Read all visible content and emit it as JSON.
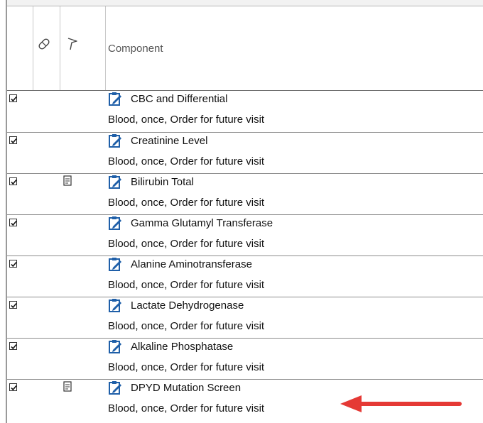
{
  "header": {
    "component_label": "Component",
    "icons": [
      "pill-icon",
      "flag-icon"
    ]
  },
  "rows": [
    {
      "name": "CBC and Differential",
      "detail": "Blood, once, Order for future visit",
      "checked": true,
      "has_note": false
    },
    {
      "name": "Creatinine Level",
      "detail": "Blood, once, Order for future visit",
      "checked": true,
      "has_note": false
    },
    {
      "name": "Bilirubin Total",
      "detail": "Blood, once, Order for future visit",
      "checked": true,
      "has_note": true
    },
    {
      "name": "Gamma Glutamyl Transferase",
      "detail": "Blood, once, Order for future visit",
      "checked": true,
      "has_note": false
    },
    {
      "name": "Alanine Aminotransferase",
      "detail": "Blood, once, Order for future visit",
      "checked": true,
      "has_note": false
    },
    {
      "name": "Lactate Dehydrogenase",
      "detail": "Blood, once, Order for future visit",
      "checked": true,
      "has_note": false
    },
    {
      "name": "Alkaline Phosphatase",
      "detail": "Blood, once, Order for future visit",
      "checked": true,
      "has_note": false
    },
    {
      "name": "DPYD Mutation Screen",
      "detail": "Blood, once, Order for future visit",
      "checked": true,
      "has_note": true
    }
  ],
  "colors": {
    "order_icon_blue": "#1f5fa8",
    "annotation_arrow": "#e53935"
  }
}
